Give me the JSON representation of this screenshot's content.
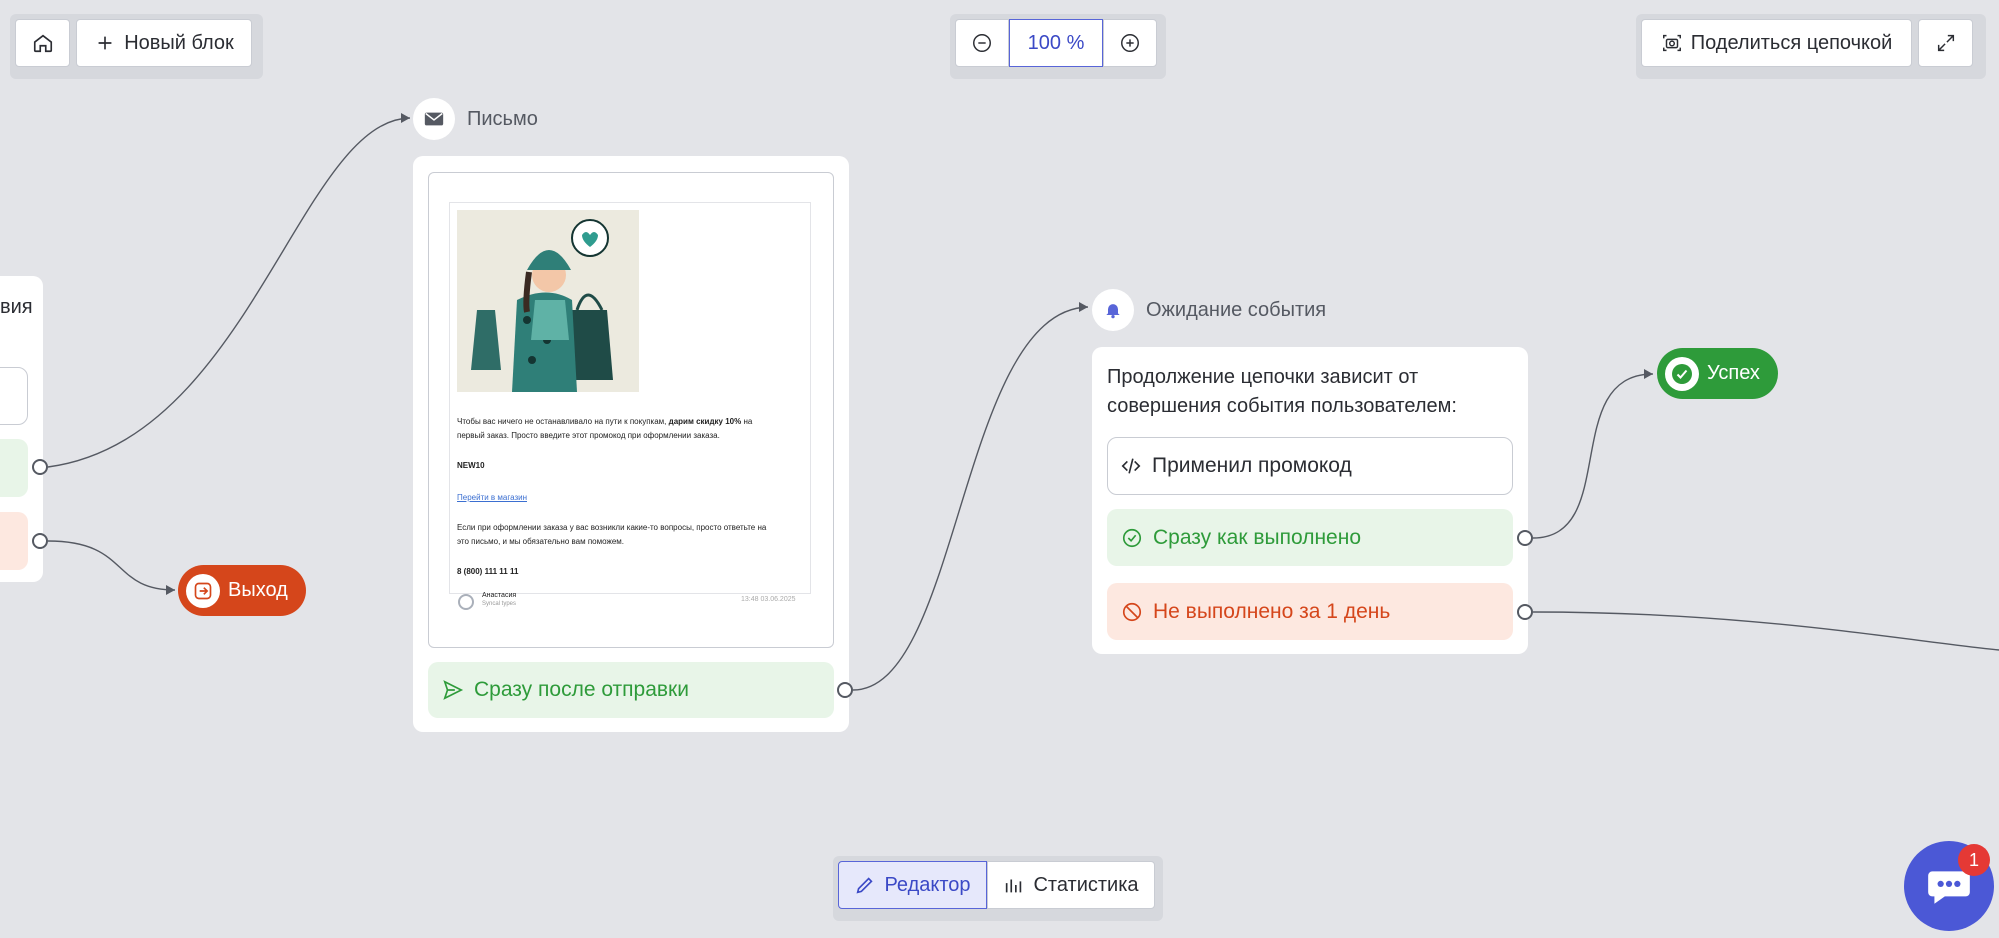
{
  "toolbar": {
    "home_icon": "home-icon",
    "new_block_label": "Новый блок",
    "zoom_value": "100 %",
    "share_label": "Поделиться цепочкой"
  },
  "left_card": {
    "title_fragment": "вия"
  },
  "exit_badge": {
    "label": "Выход",
    "color": "#d5461b"
  },
  "email_node": {
    "title": "Письмо",
    "preview": {
      "line1": "Чтобы вас ничего не останавливало на пути к покупкам,",
      "line1_bold": "дарим скидку 10%",
      "line1_end": "на",
      "line2": "первый заказ. Просто введите этот промокод при оформлении заказа.",
      "promo": "NEW10",
      "link": "Перейти в магазин",
      "line3": "Если при оформлении заказа у вас возникли какие-то вопросы, просто ответьте на",
      "line4": "это письмо, и мы обязательно вам поможем.",
      "phone": "8 (800) 111 11 11",
      "sender": "Анастасия",
      "sender_sub": "Syncal types",
      "timestamp": "13:48 03.06.2025"
    },
    "outcome": "Сразу после отправки"
  },
  "wait_node": {
    "title": "Ожидание события",
    "description": "Продолжение цепочки зависит от совершения события пользователем:",
    "event": "Применил промокод",
    "success_outcome": "Сразу как выполнено",
    "fail_outcome": "Не выполнено за 1 день"
  },
  "success_badge": {
    "label": "Успех",
    "color": "#2e9b3a"
  },
  "bottom_tabs": {
    "editor": "Редактор",
    "stats": "Статистика"
  },
  "chat": {
    "unread": "1"
  },
  "colors": {
    "accent": "#3b49c6",
    "canvas": "#e3e4e8",
    "green": "#2e9b3a",
    "red": "#d5461b"
  }
}
